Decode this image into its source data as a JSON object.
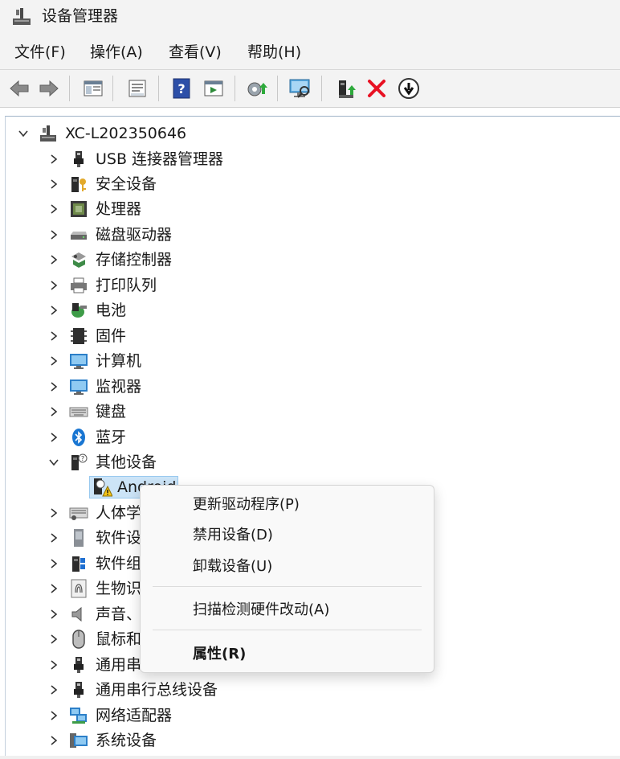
{
  "window": {
    "title": "设备管理器"
  },
  "menubar": {
    "items": [
      "文件(F)",
      "操作(A)",
      "查看(V)",
      "帮助(H)"
    ]
  },
  "toolbar": {
    "buttons": [
      "back-icon",
      "forward-icon",
      "show-hide-tree-icon",
      "properties-icon",
      "help-icon",
      "run-icon",
      "update-driver-icon",
      "scan-hardware-icon",
      "enable-device-icon",
      "uninstall-icon",
      "disable-device-icon"
    ]
  },
  "tree": {
    "root": "XC-L202350646",
    "categories": [
      "USB 连接器管理器",
      "安全设备",
      "处理器",
      "磁盘驱动器",
      "存储控制器",
      "打印队列",
      "电池",
      "固件",
      "计算机",
      "监视器",
      "键盘",
      "蓝牙",
      "其他设备"
    ],
    "selected_device": "Android",
    "after": [
      "人体学输入设备",
      "软件设备",
      "软件组件",
      "生物识别设备",
      "声音、视频和游戏控制器",
      "鼠标和其他指针设备",
      "通用串行总线控制器",
      "通用串行总线设备",
      "网络适配器",
      "系统设备"
    ]
  },
  "context_menu": {
    "update": "更新驱动程序(P)",
    "disable": "禁用设备(D)",
    "uninstall": "卸载设备(U)",
    "scan": "扫描检测硬件改动(A)",
    "properties": "属性(R)"
  },
  "colors": {
    "accent": "#0078d4",
    "error": "#e81123",
    "selection": "#cce4f7"
  }
}
